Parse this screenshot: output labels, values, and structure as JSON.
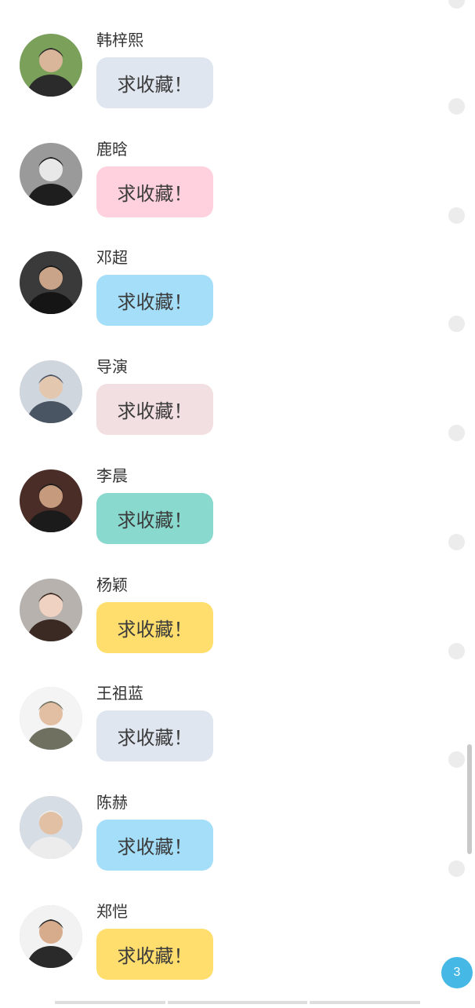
{
  "colors": {
    "gray": "#e0e6ef",
    "pink": "#ffd1de",
    "blue": "#a4def9",
    "rose": "#f2dfe1",
    "teal": "#8ad9cf",
    "yellow": "#ffde6e",
    "badge": "#45b8e6"
  },
  "items": [
    {
      "name": "韩梓熙",
      "message": "求收藏！",
      "bubble_color": "#e0e6ef"
    },
    {
      "name": "鹿晗",
      "message": "求收藏！",
      "bubble_color": "#ffd1de"
    },
    {
      "name": "邓超",
      "message": "求收藏！",
      "bubble_color": "#a4def9"
    },
    {
      "name": "导演",
      "message": "求收藏！",
      "bubble_color": "#f2dfe1"
    },
    {
      "name": "李晨",
      "message": "求收藏！",
      "bubble_color": "#8ad9cf"
    },
    {
      "name": "杨颖",
      "message": "求收藏！",
      "bubble_color": "#ffde6e"
    },
    {
      "name": "王祖蓝",
      "message": "求收藏！",
      "bubble_color": "#e0e6ef"
    },
    {
      "name": "陈赫",
      "message": "求收藏！",
      "bubble_color": "#a4def9"
    },
    {
      "name": "郑恺",
      "message": "求收藏！",
      "bubble_color": "#ffde6e"
    }
  ],
  "badge": {
    "count": "3"
  }
}
